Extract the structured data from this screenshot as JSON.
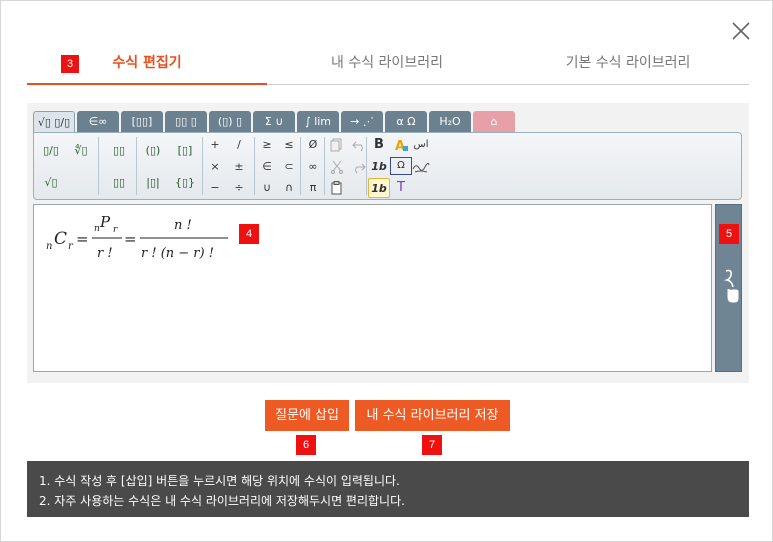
{
  "tabs": [
    {
      "label": "수식 편집기",
      "active": true
    },
    {
      "label": "내 수식 라이브러리",
      "active": false
    },
    {
      "label": "기본 수식 라이브러리",
      "active": false
    }
  ],
  "badges": {
    "b3": "3",
    "b4": "4",
    "b5": "5",
    "b6": "6",
    "b7": "7"
  },
  "toolbar_tabs": [
    "√▯ ▯/▯",
    "∈∞",
    "[▯▯]",
    "▯▯ ▯",
    "(▯) ▯",
    "Σ ∪",
    "∫ lim",
    "→ ⋰",
    "α Ω",
    "H₂O",
    "⌂"
  ],
  "palette": {
    "frac": "▯/▯",
    "nroot": "∜▯",
    "sqrt": "√▯",
    "sup": "▯▯",
    "sub": "▯▯",
    "paren": "(▯)",
    "bracket": "[▯]",
    "abs": "|▯|",
    "brace": "{▯}",
    "plus": "+",
    "slash": "/",
    "times": "×",
    "pm": "±",
    "minus": "−",
    "div": "÷",
    "ge": "≥",
    "le": "≤",
    "in": "∈",
    "subset": "⊂",
    "cup": "∪",
    "cap": "∩",
    "empty": "Ø",
    "infty": "∞",
    "pi": "π",
    "bold": "B",
    "italic_bold": "1b",
    "italic_bold2": "1b",
    "text": "T",
    "omega": "Ω",
    "arabic": "اس"
  },
  "formula": {
    "lhs_n": "n",
    "lhs_C": "C",
    "lhs_r": "r",
    "eq1": "=",
    "num1_n": "n",
    "num1_P": "P",
    "num1_r": "r",
    "den1": "r !",
    "eq2": "=",
    "num2": "n !",
    "den2": "r ! (n − r) !"
  },
  "buttons": {
    "insert": "질문에 삽입",
    "save": "내 수식 라이브러리 저장"
  },
  "info": {
    "line1": "1. 수식 작성 후 [삽입] 버튼을 누르시면 해당 위치에 수식이 입력됩니다.",
    "line2": "2. 자주 사용하는 수식은 내 수식 라이브러리에 저장해두시면 편리합니다."
  },
  "colors": {
    "accent": "#ee5a24",
    "badge": "#ee1111",
    "info_bg": "#4a4a4a",
    "toolbar": "#6b8190"
  }
}
